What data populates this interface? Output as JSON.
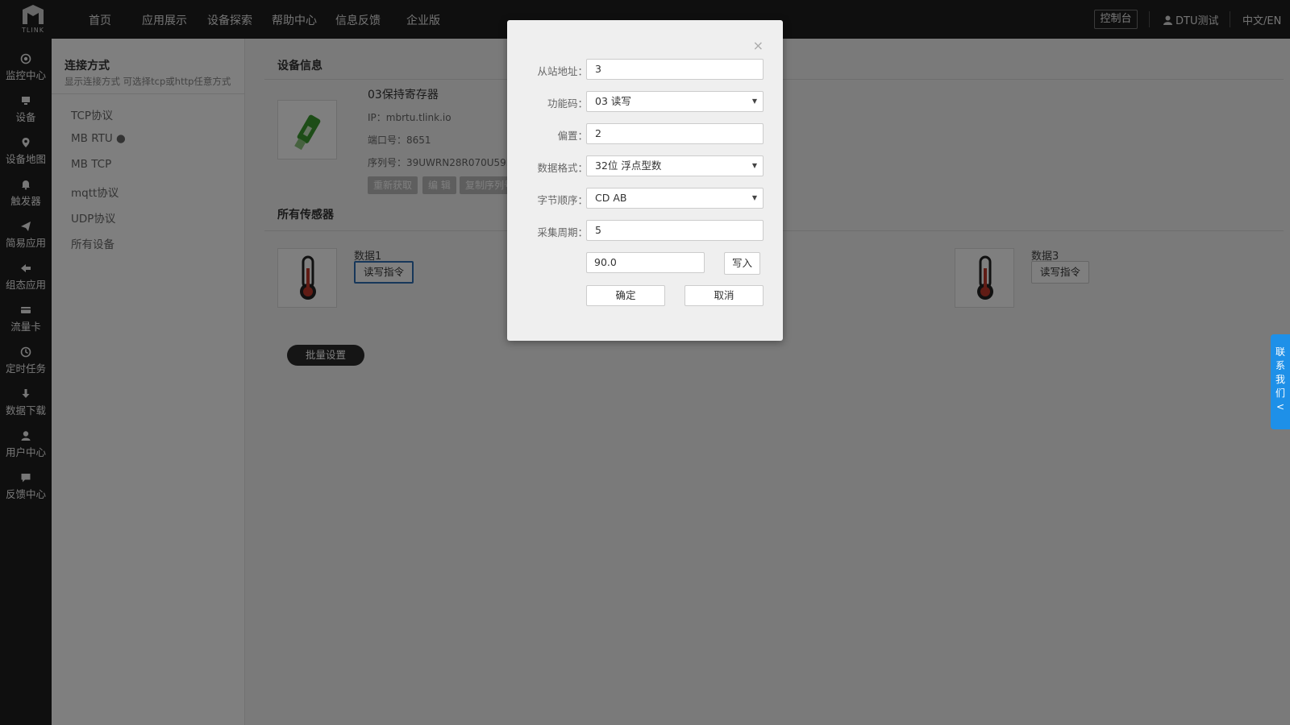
{
  "topnav": {
    "logo_text": "TLINK",
    "items": [
      "首页",
      "应用展示",
      "设备探索",
      "帮助中心",
      "信息反馈",
      "企业版"
    ],
    "console": "控制台",
    "user": "DTU测试",
    "lang": "中文/EN"
  },
  "sidebar": {
    "items": [
      {
        "label": "监控中心",
        "icon": "monitor-icon"
      },
      {
        "label": "设备",
        "icon": "device-icon"
      },
      {
        "label": "设备地图",
        "icon": "map-pin-icon"
      },
      {
        "label": "触发器",
        "icon": "bell-icon"
      },
      {
        "label": "简易应用",
        "icon": "send-icon"
      },
      {
        "label": "组态应用",
        "icon": "share-icon"
      },
      {
        "label": "流量卡",
        "icon": "card-icon"
      },
      {
        "label": "定时任务",
        "icon": "clock-icon"
      },
      {
        "label": "数据下载",
        "icon": "download-icon"
      },
      {
        "label": "用户中心",
        "icon": "user-icon"
      },
      {
        "label": "反馈中心",
        "icon": "comment-icon"
      }
    ]
  },
  "subsidebar": {
    "title": "连接方式",
    "desc": "显示连接方式 可选择tcp或http任意方式",
    "items": [
      "TCP协议",
      "MB RTU ●",
      "MB TCP",
      "mqtt协议",
      "UDP协议",
      "所有设备"
    ]
  },
  "device": {
    "section_title": "设备信息",
    "name": "03保持寄存器",
    "ip": "IP：mbrtu.tlink.io",
    "port": "端口号：8651",
    "serial": "序列号：39UWRN28R070U59K",
    "buttons": [
      "重新获取",
      "编 辑",
      "复制序列号"
    ]
  },
  "sensors": {
    "section_title": "所有传感器",
    "items": [
      {
        "name": "数据1",
        "button": "读写指令"
      },
      {
        "name": "数据3",
        "button": "读写指令"
      }
    ],
    "batch": "批量设置"
  },
  "contact": [
    "联",
    "系",
    "我",
    "们",
    "<"
  ],
  "modal": {
    "close": "×",
    "fields": [
      {
        "label": "从站地址：",
        "value": "3",
        "type": "input"
      },
      {
        "label": "功能码：",
        "value": "03 读写",
        "type": "select"
      },
      {
        "label": "偏置：",
        "value": "2",
        "type": "input"
      },
      {
        "label": "数据格式：",
        "value": "32位 浮点型数",
        "type": "select"
      },
      {
        "label": "字节顺序：",
        "value": "CD AB",
        "type": "select"
      },
      {
        "label": "采集周期：",
        "value": "5",
        "type": "input"
      }
    ],
    "write_value": "90.0",
    "write_button": "写入",
    "confirm": "确定",
    "cancel": "取消"
  }
}
